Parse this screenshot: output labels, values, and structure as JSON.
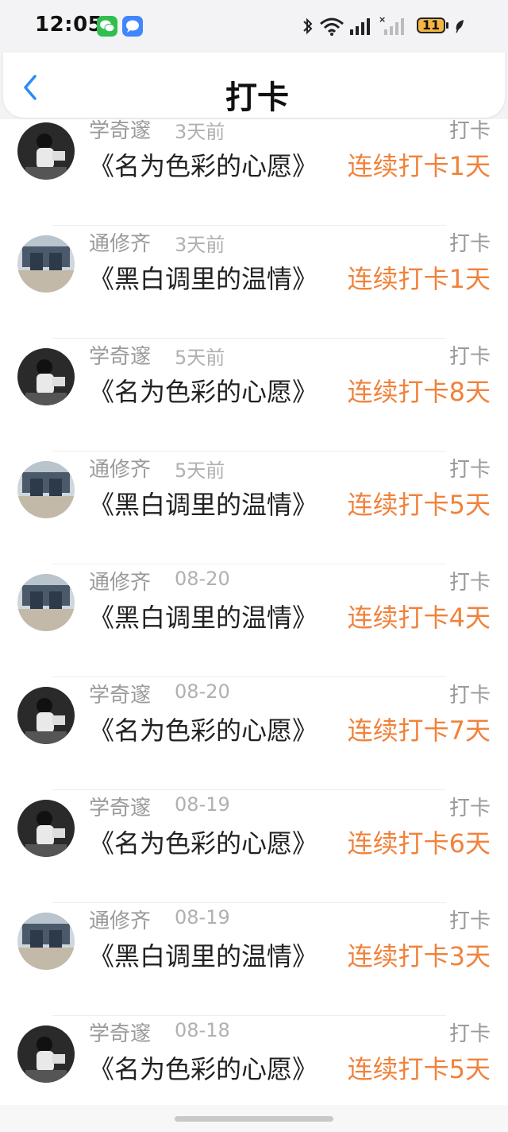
{
  "status_bar": {
    "time": "12:05",
    "icons": [
      "wechat-icon",
      "message-icon",
      "bluetooth-icon",
      "wifi-icon",
      "signal-icon",
      "signal-no-service-icon",
      "battery-icon",
      "leaf-icon"
    ],
    "battery": "11"
  },
  "header": {
    "back_icon": "chevron-left-icon",
    "title": "打卡"
  },
  "colors": {
    "accent_orange": "#f0823b",
    "back_blue": "#2b8cf3"
  },
  "records": [
    {
      "name": "学奇邃",
      "time": "3天前",
      "action": "打卡",
      "content": "《名为色彩的心愿》",
      "streak": "连续打卡1天",
      "avatar": "dark-person-avatar"
    },
    {
      "name": "通修齐",
      "time": "3天前",
      "action": "打卡",
      "content": "《黑白调里的温情》",
      "streak": "连续打卡1天",
      "avatar": "storefront-avatar"
    },
    {
      "name": "学奇邃",
      "time": "5天前",
      "action": "打卡",
      "content": "《名为色彩的心愿》",
      "streak": "连续打卡8天",
      "avatar": "dark-person-avatar"
    },
    {
      "name": "通修齐",
      "time": "5天前",
      "action": "打卡",
      "content": "《黑白调里的温情》",
      "streak": "连续打卡5天",
      "avatar": "storefront-avatar"
    },
    {
      "name": "通修齐",
      "time": "08-20",
      "action": "打卡",
      "content": "《黑白调里的温情》",
      "streak": "连续打卡4天",
      "avatar": "storefront-avatar"
    },
    {
      "name": "学奇邃",
      "time": "08-20",
      "action": "打卡",
      "content": "《名为色彩的心愿》",
      "streak": "连续打卡7天",
      "avatar": "dark-person-avatar"
    },
    {
      "name": "学奇邃",
      "time": "08-19",
      "action": "打卡",
      "content": "《名为色彩的心愿》",
      "streak": "连续打卡6天",
      "avatar": "dark-person-avatar"
    },
    {
      "name": "通修齐",
      "time": "08-19",
      "action": "打卡",
      "content": "《黑白调里的温情》",
      "streak": "连续打卡3天",
      "avatar": "storefront-avatar"
    },
    {
      "name": "学奇邃",
      "time": "08-18",
      "action": "打卡",
      "content": "《名为色彩的心愿》",
      "streak": "连续打卡5天",
      "avatar": "dark-person-avatar"
    }
  ]
}
